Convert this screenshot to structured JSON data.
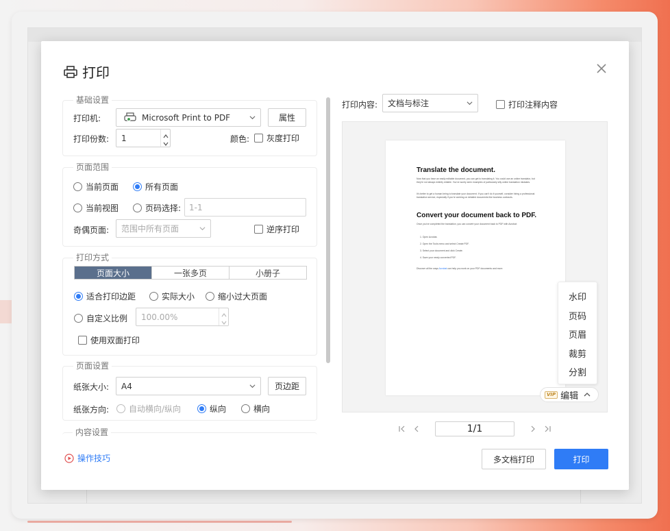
{
  "dialog": {
    "title": "打印",
    "basic": {
      "legend": "基础设置",
      "printer_label": "打印机:",
      "printer_value": "Microsoft Print to PDF",
      "properties_btn": "属性",
      "copies_label": "打印份数:",
      "copies_value": "1",
      "color_label": "颜色:",
      "grayscale_label": "灰度打印"
    },
    "range": {
      "legend": "页面范围",
      "current_page": "当前页面",
      "all_pages": "所有页面",
      "current_view": "当前视图",
      "page_select": "页码选择:",
      "page_select_placeholder": "1-1",
      "odd_even_label": "奇偶页面:",
      "odd_even_value": "范围中所有页面",
      "reverse_label": "逆序打印"
    },
    "mode": {
      "legend": "打印方式",
      "tabs": [
        "页面大小",
        "一张多页",
        "小册子"
      ],
      "fit_margin": "适合打印边距",
      "actual_size": "实际大小",
      "shrink_large": "缩小过大页面",
      "custom_scale": "自定义比例",
      "custom_scale_value": "100.00%",
      "duplex_label": "使用双面打印"
    },
    "page_setup": {
      "legend": "页面设置",
      "paper_size_label": "纸张大小:",
      "paper_size_value": "A4",
      "margins_btn": "页边距",
      "orientation_label": "纸张方向:",
      "auto_orient": "自动横向/纵向",
      "portrait": "纵向",
      "landscape": "横向"
    },
    "content_settings_legend": "内容设置",
    "print_content_label": "打印内容:",
    "print_content_value": "文档与标注",
    "print_annotations_label": "打印注释内容",
    "preview_doc": {
      "h1": "Translate the document.",
      "p1": "Now that you have an easily editable document, you can get to translating it. You could use an online translator, but they’re not always entirely reliable. You’ve surely seen examples of particularly silly online translation mistakes.",
      "p2": "It’s better to get a human being to translate your document. If you can’t do it yourself, consider hiring a professional translation service, especially if you’re working on detailed documents like business contracts.",
      "h2": "Convert your document back to PDF.",
      "p3": "Once you’ve completed the translation, you can convert your document back to PDF with Acrobat:",
      "steps": [
        "1. Open Acrobat.",
        "2. Open the Tools menu and select Create PDF.",
        "3. Select your document and click Create.",
        "4. Save your newly converted PDF."
      ],
      "p4_pre": "Discover all the ways ",
      "p4_link": "Acrobat",
      "p4_post": " can help you work on your PDF documents and more."
    },
    "edit_menu": [
      "水印",
      "页码",
      "页眉",
      "裁剪",
      "分割"
    ],
    "vip_badge": "VIP",
    "edit_label": "编辑",
    "page_indicator": "1/1",
    "tips_link": "操作技巧",
    "multi_doc_btn": "多文档打印",
    "print_btn": "打印",
    "colors": {
      "accent": "#2f7cf6",
      "tab_active": "#5a6f8c"
    }
  }
}
